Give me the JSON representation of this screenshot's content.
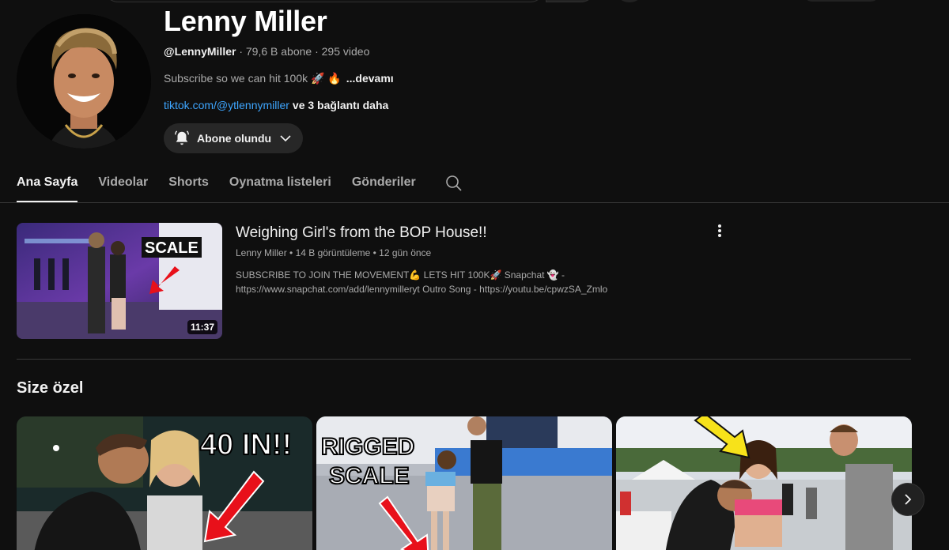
{
  "channel": {
    "name": "Lenny Miller",
    "handle": "@LennyMiller",
    "stats": " · 79,6 B abone · 295 video",
    "description": "Subscribe so we can hit 100k 🚀 🔥",
    "more_label": "...devamı",
    "link_text": "tiktok.com/@ytlennymiller",
    "extra_links": "ve 3 bağlantı daha",
    "subscribe_label": "Abone olundu"
  },
  "tabs": [
    {
      "label": "Ana Sayfa",
      "active": true
    },
    {
      "label": "Videolar"
    },
    {
      "label": "Shorts"
    },
    {
      "label": "Oynatma listeleri"
    },
    {
      "label": "Gönderiler"
    }
  ],
  "featured": {
    "title": "Weighing Girl's from the BOP House!!",
    "meta": "Lenny Miller • 14 B görüntüleme • 12 gün önce",
    "description": "SUBSCRIBE TO JOIN THE MOVEMENT💪 LETS HIT 100K🚀 Snapchat 👻 - https://www.snapchat.com/add/lennymilleryt Outro Song - https://youtu.be/cpwzSA_Zmlo",
    "duration": "11:37",
    "thumb_text": "SCALE"
  },
  "section": {
    "title": "Size özel",
    "cards": [
      {
        "thumb_text": "40 IN!!"
      },
      {
        "thumb_text_1": "RIGGED",
        "thumb_text_2": "SCALE"
      },
      {}
    ]
  },
  "icons": {
    "bell": "bell-icon",
    "chevron": "chevron-down-icon",
    "search": "search-icon",
    "kebab": "more-vert-icon",
    "next": "chevron-right-icon"
  },
  "colors": {
    "background": "#0f0f0f",
    "link": "#3ea6ff",
    "text": "#f1f1f1",
    "muted": "#aaaaaa",
    "arrow_red": "#e8101a",
    "arrow_yellow": "#f7e21a"
  }
}
